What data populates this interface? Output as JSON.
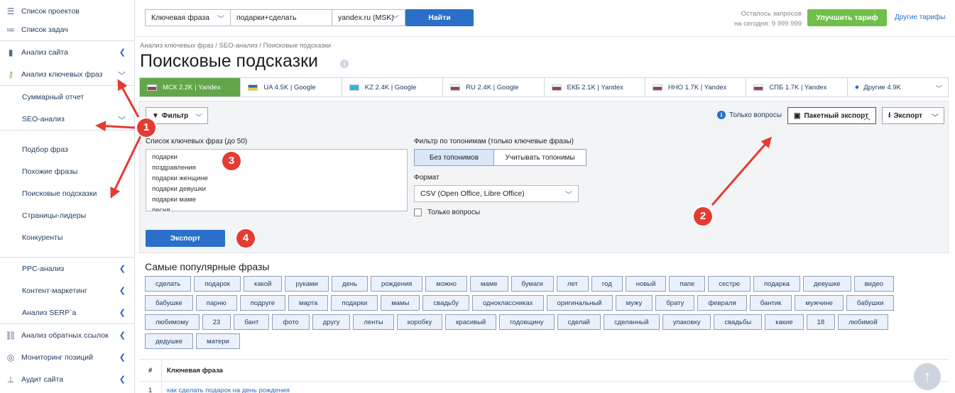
{
  "sidebar": {
    "items": [
      {
        "label": "Список проектов",
        "icon": "menu-icon"
      },
      {
        "label": "Список задач",
        "icon": "list-icon"
      },
      {
        "label": "Анализ сайта",
        "icon": "chart-icon"
      },
      {
        "label": "Анализ ключевых фраз",
        "icon": "key-icon"
      },
      {
        "label": "Суммарный отчет"
      },
      {
        "label": "SEO-анализ"
      },
      {
        "label": "Подбор фраз"
      },
      {
        "label": "Похожие фразы"
      },
      {
        "label": "Поисковые подсказки"
      },
      {
        "label": "Страницы-лидеры"
      },
      {
        "label": "Конкуренты"
      },
      {
        "label": "PPC-анализ"
      },
      {
        "label": "Контент-маркетинг"
      },
      {
        "label": "Анализ SERP`a"
      },
      {
        "label": "Анализ обратных ссылок",
        "icon": "link-icon"
      },
      {
        "label": "Мониторинг позиций",
        "icon": "target-icon"
      },
      {
        "label": "Аудит сайта",
        "icon": "sitemap-icon"
      }
    ]
  },
  "topbar": {
    "type_select": "Ключевая фраза",
    "query_value": "подарки+сделать",
    "engine_select": "yandex.ru (MSK)",
    "search_button": "Найти",
    "remaining_label": "Осталось запросов",
    "remaining_today": "на сегодня: 9 999 999",
    "upgrade_button": "Улучшить тариф",
    "other_plans": "Другие тарифы"
  },
  "breadcrumb": "Анализ ключевых фраз / SEO-анализ / Поисковые подсказки",
  "page_title": "Поисковые подсказки",
  "regions": [
    {
      "label": "МСК 2.2K | Yandex",
      "active": true,
      "flag": "ru"
    },
    {
      "label": "UA 4.5K | Google",
      "flag": "ua"
    },
    {
      "label": "KZ 2.4K | Google",
      "flag": "kz"
    },
    {
      "label": "RU 2.4K | Google",
      "flag": "ru"
    },
    {
      "label": "ЕКБ 2.1K | Yandex",
      "flag": "ru"
    },
    {
      "label": "ННО 1.7K | Yandex",
      "flag": "ru"
    },
    {
      "label": "СПБ 1.7K | Yandex",
      "flag": "ru"
    },
    {
      "label": "Другие 4.9K",
      "flag": "globe"
    }
  ],
  "toolbar": {
    "filter_button": "Фильтр",
    "only_questions_link": "Только вопросы",
    "batch_export": "Пакетный экспорт",
    "export_dropdown": "Экспорт"
  },
  "panel": {
    "keywords_label": "Список ключевых фраз (до 50)",
    "keywords_text": "подарки\nпоздравления\nподарки женщине\nподарки девушки\nподарки маме\nпесня",
    "toponym_label": "Фильтр по топонимам (только ключевые фразы)",
    "toponym_off": "Без топонимов",
    "toponym_on": "Учитывать топонимы",
    "format_label": "Формат",
    "format_value": "CSV (Open Office, Libre Office)",
    "only_questions": "Только вопросы",
    "export_button": "Экспорт"
  },
  "popular": {
    "title": "Самые популярные фразы",
    "tags": [
      "сделать",
      "подарок",
      "какой",
      "руками",
      "день",
      "рождения",
      "можно",
      "маме",
      "бумаги",
      "лет",
      "год",
      "новый",
      "папе",
      "сестре",
      "подарка",
      "девушке",
      "видео",
      "бабушке",
      "парню",
      "подруге",
      "марта",
      "подарки",
      "мамы",
      "свадьбу",
      "одноклассниках",
      "оригинальный",
      "мужу",
      "брату",
      "февраля",
      "бантик",
      "мужчине",
      "бабушки",
      "любимому",
      "23",
      "бант",
      "фото",
      "другу",
      "ленты",
      "коробку",
      "красивый",
      "годовщину",
      "сделай",
      "сделанный",
      "упаковку",
      "свадьбы",
      "какие",
      "18",
      "любимой",
      "дедушке",
      "матери"
    ]
  },
  "table": {
    "col_num": "#",
    "col_phrase": "Ключевая фраза",
    "rows": [
      {
        "num": "1",
        "phrase": "как сделать подарок на день рождения"
      }
    ]
  },
  "annotations": {
    "b1": "1",
    "b2": "2",
    "b3": "3",
    "b4": "4"
  },
  "colors": {
    "accent": "#2a6fc9",
    "active_region": "#62a64a",
    "upgrade": "#6fbf4a",
    "badge": "#e43b33"
  }
}
